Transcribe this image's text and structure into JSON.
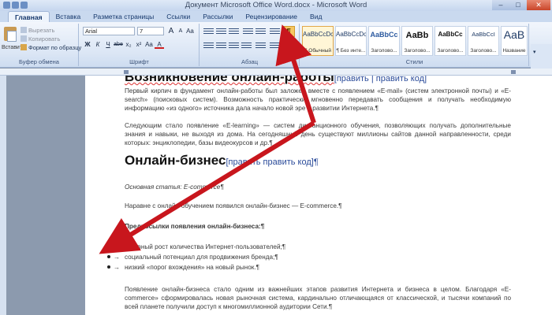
{
  "window": {
    "title": "Документ Microsoft Office Word.docx - Microsoft Word",
    "min": "–",
    "max": "□",
    "close": "✕"
  },
  "tabs": [
    "Главная",
    "Вставка",
    "Разметка страницы",
    "Ссылки",
    "Рассылки",
    "Рецензирование",
    "Вид"
  ],
  "ribbon": {
    "clipboard": {
      "paste": "Вставить",
      "cut": "Вырезать",
      "copy": "Копировать",
      "format_painter": "Формат по образцу",
      "group_label": "Буфер обмена"
    },
    "font": {
      "name": "Arial",
      "size": "7",
      "group_label": "Шрифт",
      "buttons": [
        "Ж",
        "К",
        "Ч",
        "abe",
        "x₂",
        "x²",
        "Aa",
        "A"
      ],
      "grow_shrink": [
        "A",
        "A",
        "Aa"
      ]
    },
    "paragraph": {
      "group_label": "Абзац",
      "pilcrow": "¶"
    },
    "styles": {
      "group_label": "Стили",
      "items": [
        {
          "sample": "AaBbCcDc",
          "name": "¶ Обычный"
        },
        {
          "sample": "AaBbCcDc",
          "name": "¶ Без инте..."
        },
        {
          "sample": "AaBbCc",
          "name": "Заголово..."
        },
        {
          "sample": "AaBb",
          "name": "Заголово..."
        },
        {
          "sample": "AaBbCc",
          "name": "Заголово..."
        },
        {
          "sample": "AaBbCcI",
          "name": "Заголово..."
        },
        {
          "sample": "AaB",
          "name": "Название"
        }
      ],
      "more": "▾"
    }
  },
  "document": {
    "heading1_partial": "Возникновение онлайн-работы",
    "heading1_edit": "[править | править код]",
    "para1": "Первый кирпич в фундамент онлайн-работы был заложен вместе с появлением «E-mail» (систем электронной почты) и «E-search» (поисковых систем). Возможность практически мгновенно передавать сообщения и получать необходимую информацию «из одного» источника дала начало новой эре в развитии Интернета.¶",
    "para2": "Следующим стало появление «E-learning» — систем дистанционного обучения, позволяющих получать дополнительные знания и навыки, не выходя из дома. На сегодняшний день существуют миллионы сайтов данной направленности, среди которых: энциклопедии, базы видеокурсов и др.¶",
    "heading2": "Онлайн-бизнес",
    "heading2_edit": "[править править код]¶",
    "main_article": "Основная статья: E-commerce¶",
    "para3": "Наравне с онлайн-обучением появился онлайн-бизнес — E-commerce.¶",
    "prereq": "Предпосылки появления онлайн-бизнеса:¶",
    "bullets": [
      "активный рост количества Интернет-пользователей;¶",
      "социальный потенциал для продвижения бренда;¶",
      "низкий «порог вхождения» на новый рынок.¶"
    ],
    "para4": "Появление онлайн-бизнеса стало одним из важнейших этапов развития Интернета и бизнеса в целом. Благодаря «E-commerce» сформировалась новая рыночная система, кардинально отличающаяся от классической, и тысячи компаний по всей планете получили доступ к многомиллионной аудитории Сети.¶"
  },
  "colors": {
    "arrow": "#c8161d",
    "ribbon_bg": "#dbe6f5",
    "highlight_button": "#f6c763"
  }
}
